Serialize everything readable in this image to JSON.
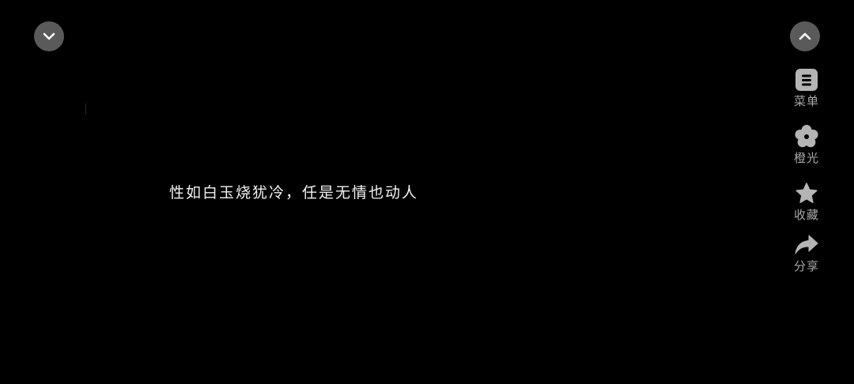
{
  "top_controls": {
    "collapse_icon": "chevron-down-icon",
    "expand_icon": "chevron-up-icon"
  },
  "side_menu": {
    "items": [
      {
        "label": "菜单",
        "icon": "menu-doc-icon"
      },
      {
        "label": "橙光",
        "icon": "orange-light-flower-icon"
      },
      {
        "label": "收藏",
        "icon": "star-icon"
      },
      {
        "label": "分享",
        "icon": "share-arrow-icon"
      }
    ]
  },
  "story": {
    "text": "性如白玉烧犹冷，任是无情也动人"
  },
  "colors": {
    "background": "#000000",
    "button_bg": "#5a5a5a",
    "icon": "#b4b4b4",
    "label": "#a9a9a9",
    "story_text": "#f2f2f2"
  }
}
